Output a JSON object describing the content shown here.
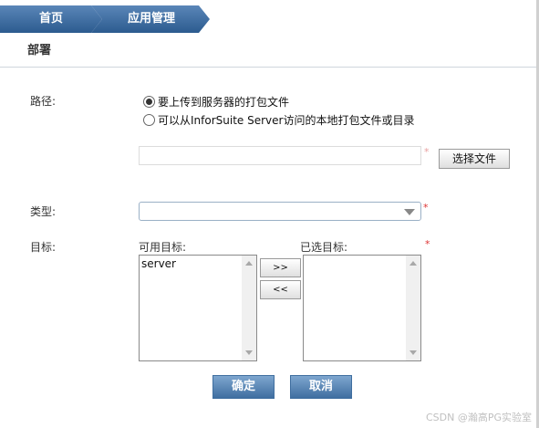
{
  "breadcrumb": {
    "home": "首页",
    "app_management": "应用管理"
  },
  "section_title": "部署",
  "form": {
    "path_label": "路径:",
    "radio_upload": "要上传到服务器的打包文件",
    "radio_local": "可以从InforSuite Server访问的本地打包文件或目录",
    "file_path_value": "",
    "choose_file_label": "选择文件",
    "type_label": "类型:",
    "type_selected": "",
    "target_label": "目标:",
    "available_targets_label": "可用目标:",
    "selected_targets_label": "已选目标:",
    "available_targets": [
      "server"
    ],
    "selected_targets": [],
    "add_button": ">>",
    "remove_button": "<<",
    "required_mark": "*"
  },
  "actions": {
    "confirm": "确定",
    "cancel": "取消"
  },
  "watermark": "CSDN @瀚高PG实验室",
  "colors": {
    "breadcrumb_blue": "#2f5f93",
    "button_blue": "#4a78a8",
    "required_red": "#d33333"
  },
  "icons": {
    "dropdown": "chevron-down-icon",
    "radio": "radio-icon"
  }
}
